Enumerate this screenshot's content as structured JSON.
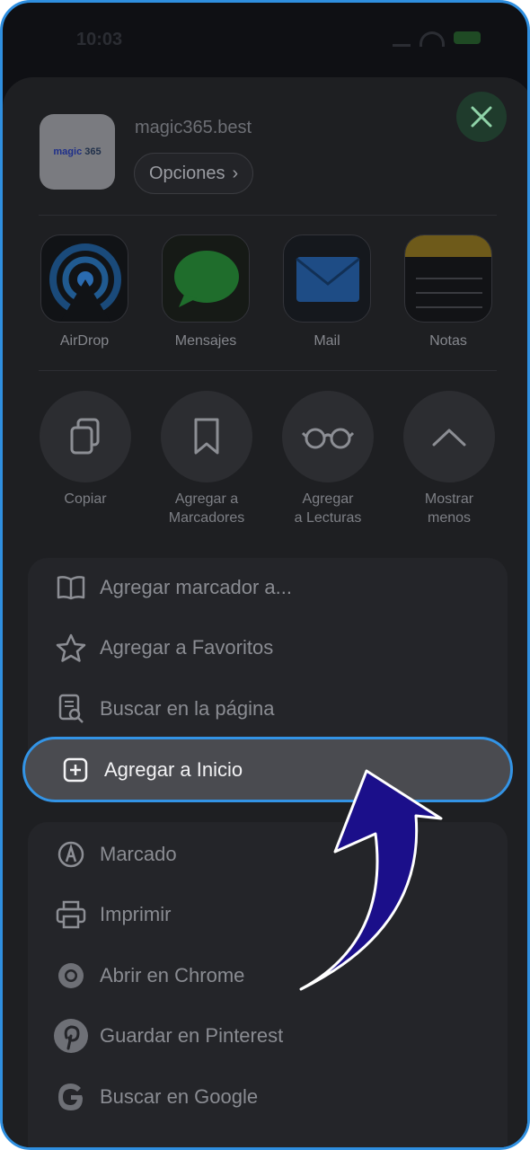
{
  "status": {
    "time": "10:03"
  },
  "site": {
    "domain": "magic365.best",
    "logo_text": "magic",
    "logo_digits": "365",
    "options_label": "Opciones",
    "options_chevron": "›"
  },
  "apps": [
    {
      "label": "AirDrop",
      "icon": "airdrop-icon"
    },
    {
      "label": "Mensajes",
      "icon": "messages-icon"
    },
    {
      "label": "Mail",
      "icon": "mail-icon"
    },
    {
      "label": "Notas",
      "icon": "notes-icon"
    }
  ],
  "actions": [
    {
      "line1": "Copiar",
      "line2": "",
      "icon": "copy-icon"
    },
    {
      "line1": "Agregar a",
      "line2": "Marcadores",
      "icon": "bookmark-icon"
    },
    {
      "line1": "Agregar",
      "line2": "a Lecturas",
      "icon": "glasses-icon"
    },
    {
      "line1": "Mostrar",
      "line2": "menos",
      "icon": "chevron-up-icon"
    }
  ],
  "menu1": [
    {
      "label": "Agregar marcador a...",
      "icon": "book-icon"
    },
    {
      "label": "Agregar a Favoritos",
      "icon": "star-icon"
    },
    {
      "label": "Buscar en la página",
      "icon": "find-in-page-icon"
    }
  ],
  "highlighted": {
    "label": "Agregar a Inicio",
    "icon": "add-square-icon"
  },
  "menu2": [
    {
      "label": "Marcado",
      "icon": "markup-icon"
    },
    {
      "label": "Imprimir",
      "icon": "printer-icon"
    },
    {
      "label": "Abrir en Chrome",
      "icon": "chrome-icon"
    },
    {
      "label": "Guardar en Pinterest",
      "icon": "pinterest-icon"
    },
    {
      "label": "Buscar en Google",
      "icon": "google-icon"
    }
  ],
  "colors": {
    "highlight_border": "#3394e6",
    "arrow_fill": "#1b0f8a",
    "close_green": "#1f3b2c"
  }
}
